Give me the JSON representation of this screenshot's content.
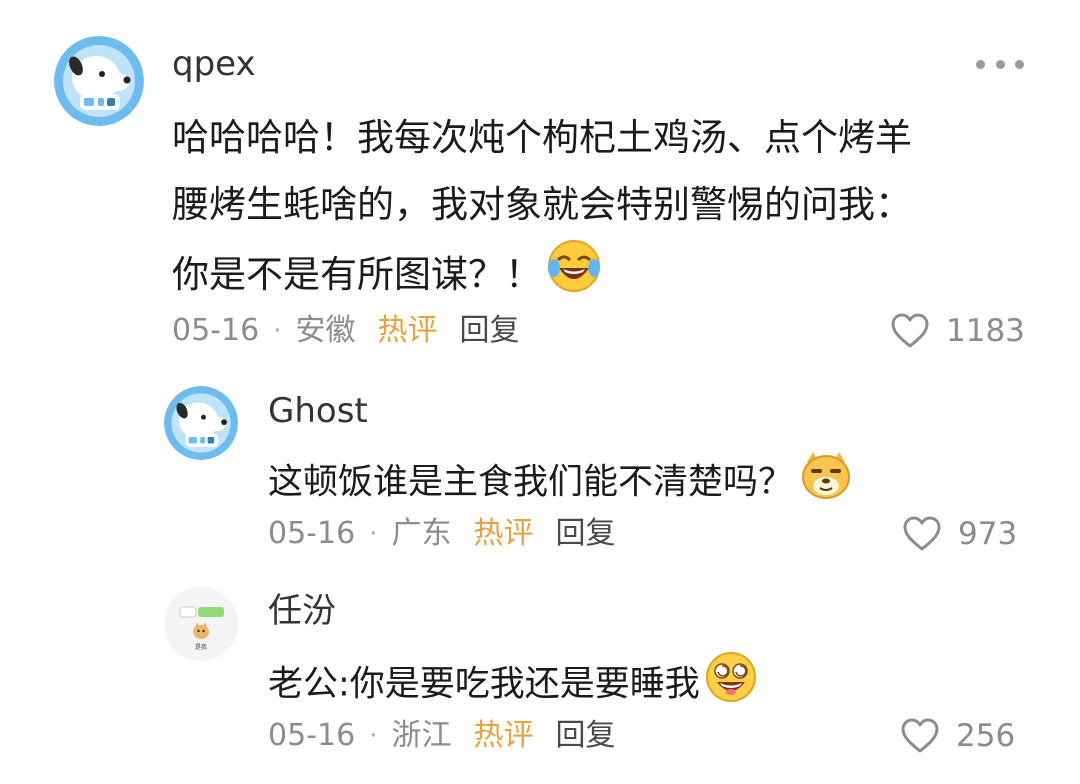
{
  "comments": [
    {
      "username": "qpex",
      "content_lines": [
        "哈哈哈哈！我每次炖个枸杞土鸡汤、点个烤羊",
        "腰烤生蚝啥的，我对象就会特别警惕的问我：",
        "你是不是有所图谋？！"
      ],
      "emoji": "laughing-tears-emoji",
      "date": "05-16",
      "location": "安徽",
      "hot_label": "热评",
      "reply_label": "回复",
      "likes": "1183"
    },
    {
      "username": "Ghost",
      "content_lines": [
        "这顿饭谁是主食我们能不清楚吗？"
      ],
      "emoji": "smug-dog-emoji",
      "date": "05-16",
      "location": "广东",
      "hot_label": "热评",
      "reply_label": "回复",
      "likes": "973"
    },
    {
      "username": "任汾",
      "content_lines": [
        "老公:你是要吃我还是要睡我"
      ],
      "emoji": "dizzy-grin-emoji",
      "date": "05-16",
      "location": "浙江",
      "hot_label": "热评",
      "reply_label": "回复",
      "likes": "256"
    }
  ],
  "avatar3_caption": "是我",
  "colors": {
    "hot": "#e8a33d",
    "meta": "#8c8c8c",
    "avatar_blue": "#63b6e8"
  }
}
